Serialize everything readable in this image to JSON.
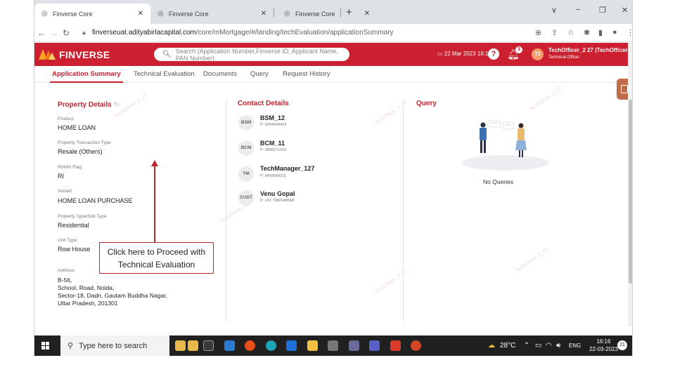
{
  "browser": {
    "tabs": [
      {
        "title": "Finverse Core",
        "active": true
      },
      {
        "title": "Finverse Core",
        "active": false
      },
      {
        "title": "Finverse Core",
        "active": false
      }
    ],
    "new_tab": "+",
    "url_host": "finverseuat.adityabirlacapital.com",
    "url_path": "/core/mMortgage/#/landing/techEvaluation/applicationSummary",
    "window_controls": [
      "∨",
      "−",
      "❐",
      "✕"
    ]
  },
  "header": {
    "brand": "FINVERSE",
    "search_placeholder": "Search (Application Number,Finverse ID, Applicant Name, PAN Number)",
    "date": "22 Mar 2023 16:16",
    "notification_count": "3",
    "avatar_initials": "T2",
    "user_name": "TechOfficer_2 27 (TechOfficer_2_27)",
    "user_role": "Technical Officer",
    "brand_color": "#cc1f2f"
  },
  "tabs": [
    "Application Summary",
    "Technical Evaluation",
    "Documents",
    "Query",
    "Request History"
  ],
  "property": {
    "heading": "Property Details",
    "fields": [
      {
        "label": "Product",
        "value": "HOME LOAN"
      },
      {
        "label": "Property Transaction Type",
        "value": "Resale (Others)"
      },
      {
        "label": "RI/NRI Flag",
        "value": "RI"
      },
      {
        "label": "Variant",
        "value": "HOME LOAN PURCHASE"
      },
      {
        "label": "Property Type/Sub Type",
        "value": "Residential"
      },
      {
        "label": "Unit Type",
        "value": "Row House"
      },
      {
        "label": "Address",
        "value": ""
      }
    ],
    "address_lines": [
      "B-56,",
      "School, Road, Noida,",
      "Sector-18, Dadri, Gautam Buddha Nagar,",
      "Uttar Pradesh, 201301"
    ]
  },
  "contacts": {
    "heading": "Contact Details",
    "items": [
      {
        "badge": "BSM",
        "name": "BSM_12",
        "phone": "P: 9494949494"
      },
      {
        "badge": "BCM",
        "name": "BCM_11",
        "phone": "P: 8898271159"
      },
      {
        "badge": "TM",
        "name": "TechManager_127",
        "phone": "P: 9443684211"
      },
      {
        "badge": "CUST",
        "name": "Venu Gopal",
        "phone": "P: +91 7982648568"
      }
    ]
  },
  "query": {
    "heading": "Query",
    "empty_text": "No Queries"
  },
  "callout": {
    "line1": "Click here to Proceed with",
    "line2": "Technical Evaluation",
    "color": "#c0272d"
  },
  "taskbar": {
    "search_placeholder": "Type here to search",
    "weather": "28°C",
    "lang": "ENG",
    "time": "16:16",
    "date": "22-03-2023",
    "notif_count": "21"
  }
}
